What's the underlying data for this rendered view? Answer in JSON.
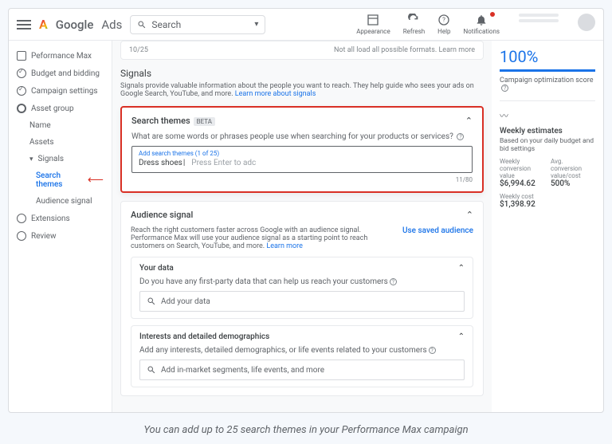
{
  "header": {
    "brand1": "Google",
    "brand2": "Ads",
    "search_label": "Search",
    "icons": {
      "appearance": "Appearance",
      "refresh": "Refresh",
      "help": "Help",
      "notifications": "Notifications"
    }
  },
  "sidebar": {
    "perf_max": "Peformance Max",
    "budget": "Budget and bidding",
    "campaign": "Campaign settings",
    "asset_group": "Asset group",
    "name": "Name",
    "assets": "Assets",
    "signals": "Signals",
    "search_themes": "Search themes",
    "audience_signal": "Audience signal",
    "extensions": "Extensions",
    "review": "Review"
  },
  "main": {
    "remnant_count": "10/25",
    "remnant_text": "Not all load all possible formats. Learn more",
    "signals_title": "Signals",
    "signals_desc": "Signals provide valuable information about the people you want to reach. They help guide who sees your ads on Google Search, YouTube, and more.",
    "signals_link": "Learn more about signals",
    "search_themes": {
      "title": "Search themes",
      "badge": "BETA",
      "question": "What are some words or phrases people use when searching for your products or services?",
      "box_label": "Add search themes (1 of 25)",
      "chip": "Dress shoes",
      "placeholder": "Press Enter to adc",
      "counter": "11/80"
    },
    "audience": {
      "title": "Audience signal",
      "desc": "Reach the right customers faster across Google with an audience signal. Performance Max will use your audience signal as a starting point to reach customers on Search, YouTube, and more.",
      "link": "Learn more",
      "use_saved": "Use saved audience",
      "your_data": {
        "title": "Your data",
        "question": "Do you have any first-party data that can help us reach your customers",
        "placeholder": "Add your data"
      },
      "interests": {
        "title": "Interests and detailed demographics",
        "question": "Add any interests, detailed demographics, or life events related to your customers",
        "placeholder": "Add in-market segments, life events, and more"
      }
    }
  },
  "right": {
    "score": "100%",
    "score_label": "Campaign optimization score",
    "est_title": "Weekly estimates",
    "est_sub": "Based on your daily budget and bid settings",
    "conv_label": "Weekly conversion value",
    "conv_val": "$6,994.62",
    "rate_label": "Avg. conversion value/cost",
    "rate_val": "500%",
    "cost_label": "Weekly cost",
    "cost_val": "$1,398.92"
  },
  "caption": "You can add up to 25 search themes in your Performance Max campaign"
}
